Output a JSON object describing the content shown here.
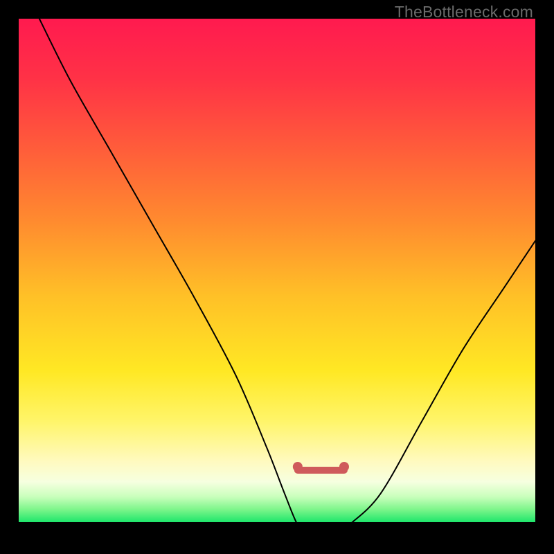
{
  "watermark": "TheBottleneck.com",
  "colors": {
    "black": "#000000",
    "curve": "#000000",
    "marker": "#cf5b5b",
    "gradient_stops": [
      {
        "offset": 0.0,
        "color": "#ff1a4f"
      },
      {
        "offset": 0.12,
        "color": "#ff3246"
      },
      {
        "offset": 0.25,
        "color": "#ff5a3b"
      },
      {
        "offset": 0.4,
        "color": "#ff8a2f"
      },
      {
        "offset": 0.55,
        "color": "#ffc027"
      },
      {
        "offset": 0.7,
        "color": "#ffe824"
      },
      {
        "offset": 0.8,
        "color": "#fff56a"
      },
      {
        "offset": 0.88,
        "color": "#fffac0"
      },
      {
        "offset": 0.92,
        "color": "#f6ffe0"
      },
      {
        "offset": 0.95,
        "color": "#c8ffbb"
      },
      {
        "offset": 0.975,
        "color": "#7cf58a"
      },
      {
        "offset": 1.0,
        "color": "#1ee66b"
      }
    ],
    "gradient_height_fraction": 0.975,
    "brown_band_center_fraction": 0.874
  },
  "chart_data": {
    "type": "line",
    "title": "",
    "xlabel": "",
    "ylabel": "",
    "xlim": [
      0,
      100
    ],
    "ylim": [
      0,
      100
    ],
    "grid": false,
    "legend": false,
    "series": [
      {
        "name": "bottleneck-curve",
        "x": [
          4,
          10,
          18,
          26,
          34,
          42,
          48,
          51.5,
          54,
          56,
          60,
          62,
          64,
          70,
          78,
          86,
          94,
          100
        ],
        "values": [
          100,
          88,
          74,
          60,
          46,
          31,
          17,
          8,
          2,
          0,
          0,
          0,
          2,
          8,
          22,
          36,
          48,
          57
        ]
      }
    ],
    "flat_bottom": {
      "x_start": 54,
      "x_end": 63,
      "y": 0
    },
    "markers": [
      {
        "x": 54,
        "y": 2
      },
      {
        "x": 63,
        "y": 2
      }
    ]
  }
}
